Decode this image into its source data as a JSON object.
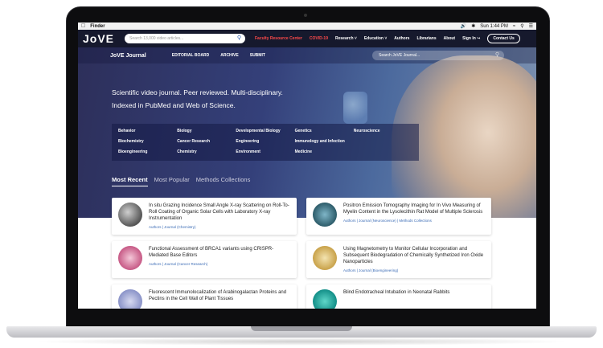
{
  "menubar": {
    "app": "Finder",
    "time": "Sun 1:44 PM"
  },
  "nav": {
    "logo": "JoVE",
    "search_placeholder": "Search 13,000 video articles...",
    "links": [
      "Faculty Resource Center",
      "COVID-19",
      "Research",
      "Education",
      "Authors",
      "Librarians",
      "About",
      "Sign In"
    ],
    "contact": "Contact Us"
  },
  "journal": {
    "title": "JoVE Journal",
    "links": [
      "EDITORIAL BOARD",
      "ARCHIVE",
      "SUBMIT"
    ],
    "search_placeholder": "Search JoVE Journal..."
  },
  "hero": {
    "line1": "Scientific video journal. Peer reviewed. Multi-disciplinary.",
    "line2": "Indexed in PubMed and Web of Science."
  },
  "subjects": [
    "Behavior",
    "Biology",
    "Developmental Biology",
    "Genetics",
    "Neuroscience",
    "Biochemistry",
    "Cancer Research",
    "Engineering",
    "Immunology and Infection",
    "",
    "Bioengineering",
    "Chemistry",
    "Environment",
    "Medicine",
    ""
  ],
  "tabs": [
    "Most Recent",
    "Most Popular",
    "Methods Collections"
  ],
  "articles": [
    {
      "title": "In situ Grazing Incidence Small Angle X-ray Scattering on Roll-To-Roll Coating of Organic Solar Cells with Laboratory X-ray Instrumentation",
      "meta": "Authors | Journal (Chemistry)"
    },
    {
      "title": "Positron Emission Tomography Imaging for In Vivo Measuring of Myelin Content in the Lysolecithin Rat Model of Multiple Sclerosis",
      "meta": "Authors | Journal (Neuroscience) | Methods Collections"
    },
    {
      "title": "Functional Assessment of BRCA1 variants using CRISPR-Mediated Base Editors",
      "meta": "Authors | Journal (Cancer Research)"
    },
    {
      "title": "Using Magnetometry to Monitor Cellular Incorporation and Subsequent Biodegradation of Chemically Synthetized Iron Oxide Nanoparticles",
      "meta": "Authors | Journal (Bioengineering)"
    },
    {
      "title": "Fluorescent Immunolocalization of Arabinogalactan Proteins and Pectins in the Cell Wall of Plant Tissues",
      "meta": ""
    },
    {
      "title": "Blind Endotracheal Intubation in Neonatal Rabbits",
      "meta": ""
    }
  ],
  "colors": {
    "nav_bg": "#16192d",
    "accent_red": "#e23b3b"
  }
}
